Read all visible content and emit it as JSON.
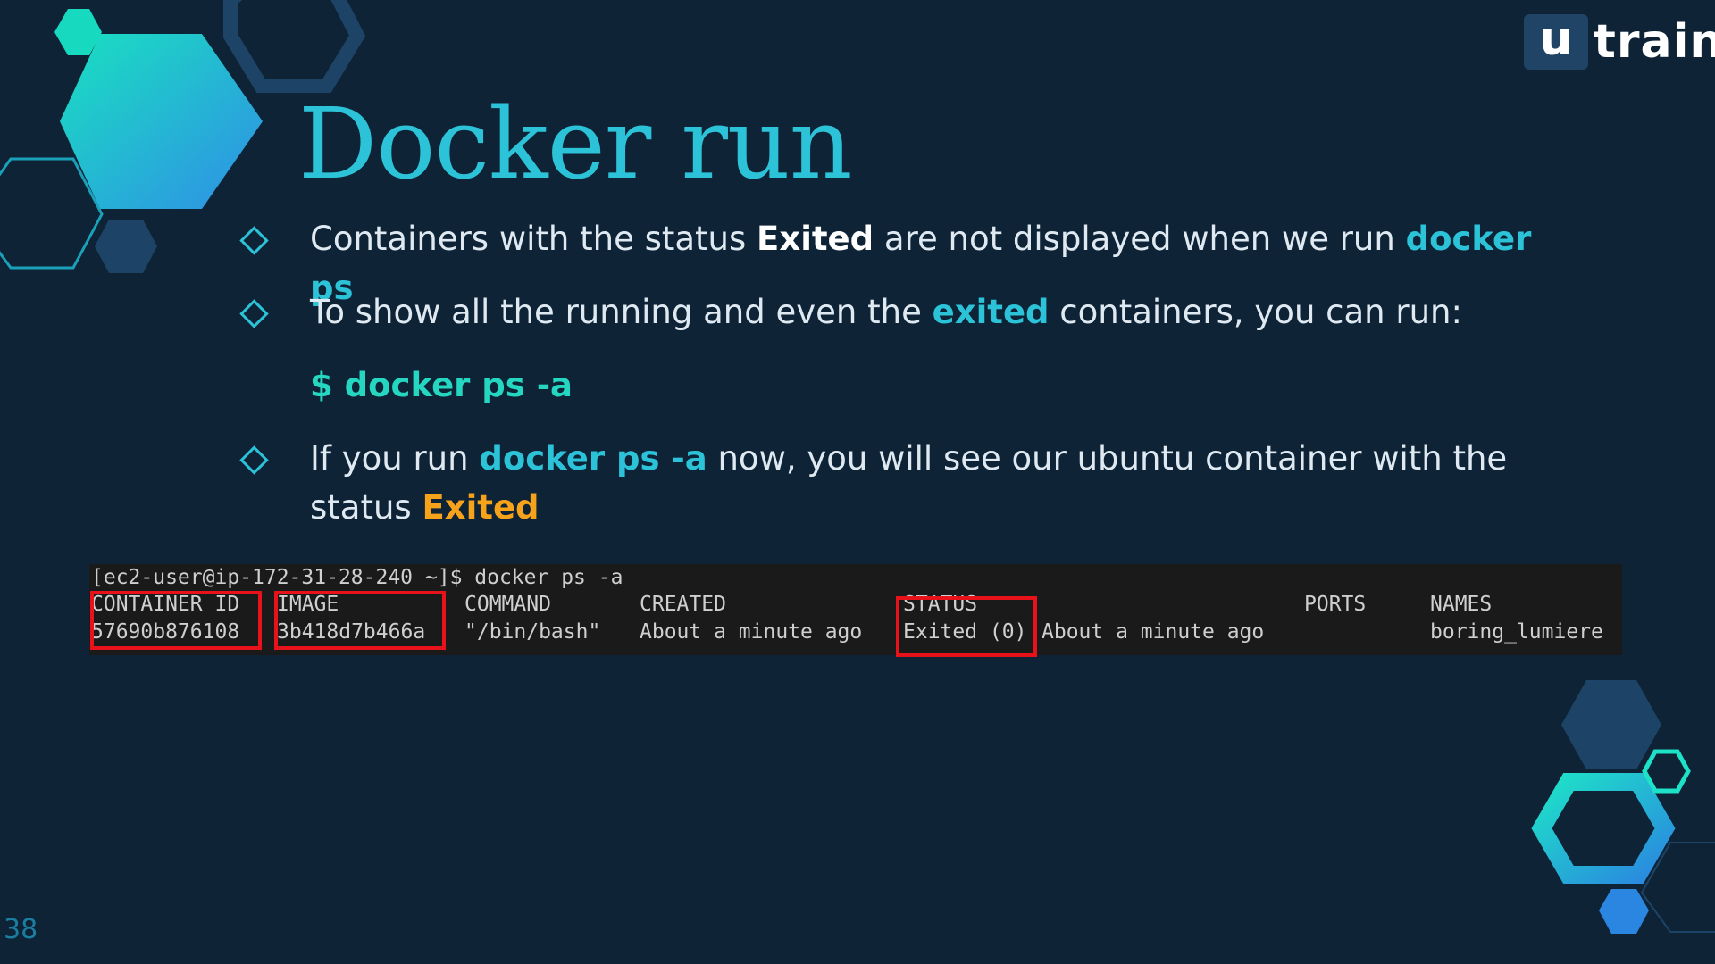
{
  "logo": {
    "badge": "u",
    "word": "train"
  },
  "title": "Docker run",
  "bullets": [
    {
      "parts": [
        {
          "text": "Containers with the status ",
          "style": "normal"
        },
        {
          "text": "Exited",
          "style": "strong"
        },
        {
          "text": " are not displayed when we run ",
          "style": "normal"
        },
        {
          "text": "docker ps",
          "style": "cyan"
        }
      ]
    },
    {
      "parts": [
        {
          "text": "To show all the running and even the ",
          "style": "normal"
        },
        {
          "text": "exited",
          "style": "cyan"
        },
        {
          "text": " containers, you can run:",
          "style": "normal"
        }
      ]
    },
    {
      "command": "$ docker ps -a"
    },
    {
      "parts": [
        {
          "text": "If you run ",
          "style": "normal"
        },
        {
          "text": "docker ps -a",
          "style": "cyan"
        },
        {
          "text": " now, you will see our ubuntu container with the status ",
          "style": "normal"
        },
        {
          "text": "Exited",
          "style": "orange"
        }
      ]
    }
  ],
  "terminal": {
    "prompt": "[ec2-user@ip-172-31-28-240 ~]$ docker ps -a",
    "headers": {
      "container_id": "CONTAINER ID",
      "image": "IMAGE",
      "command": "COMMAND",
      "created": "CREATED",
      "status": "STATUS",
      "ports": "PORTS",
      "names": "NAMES"
    },
    "row": {
      "container_id": "57690b876108",
      "image": "3b418d7b466a",
      "command": "\"/bin/bash\"",
      "created": "About a minute ago",
      "status": "Exited (0)",
      "status_time": "About a minute ago",
      "ports": "",
      "names": "boring_lumiere"
    }
  },
  "page_number": "38",
  "colors": {
    "background": "#0e2336",
    "accent_cyan": "#2cc3d8",
    "command_teal": "#25d6c0",
    "status_orange": "#f7a21b",
    "highlight_red": "#e8121b"
  }
}
